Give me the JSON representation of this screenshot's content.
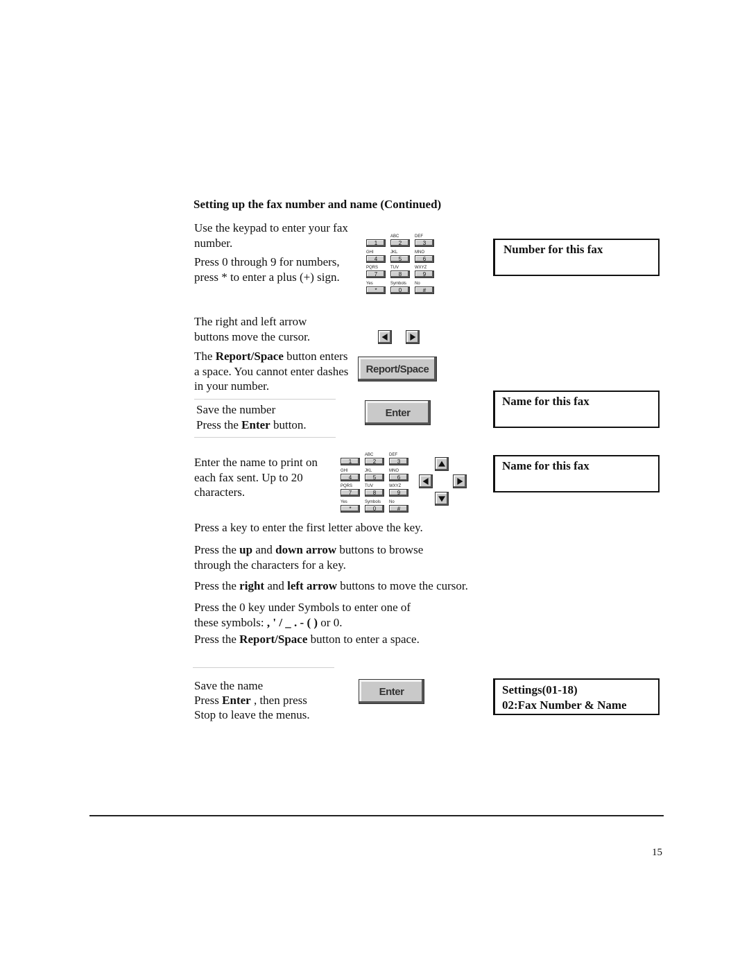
{
  "section_title": "Setting up the fax number and name (Continued)",
  "number_step": {
    "text_1": "Use the keypad to enter your fax number.",
    "text_2": "Press 0 through 9 for numbers, press * to enter a plus (+) sign.",
    "lcd": "Number for this fax"
  },
  "cursor_step": {
    "text": "The right and left arrow buttons move the cursor."
  },
  "space_step": {
    "text_pre": "The ",
    "text_bold": "Report/Space",
    "text_post": " button enters a space.  You cannot enter dashes in your number.",
    "button_label": "Report/Space"
  },
  "save_number_step": {
    "line_1": "Save the number",
    "line_2_pre": "Press the ",
    "line_2_bold": "Enter",
    "line_2_post": " button.",
    "button_label": "Enter",
    "lcd": "Name for this fax"
  },
  "name_step": {
    "text": "Enter the name to print on each fax sent.  Up to 20 characters.",
    "lcd": "Name for this fax"
  },
  "keypad": [
    {
      "sub": "",
      "key": "1"
    },
    {
      "sub": "ABC",
      "key": "2"
    },
    {
      "sub": "DEF",
      "key": "3"
    },
    {
      "sub": "GHI",
      "key": "4"
    },
    {
      "sub": "JKL",
      "key": "5"
    },
    {
      "sub": "MNO",
      "key": "6"
    },
    {
      "sub": "PQRS",
      "key": "7"
    },
    {
      "sub": "TUV",
      "key": "8"
    },
    {
      "sub": "WXYZ",
      "key": "9"
    },
    {
      "sub": "Yes",
      "key": "*"
    },
    {
      "sub": "Symbols",
      "key": "0"
    },
    {
      "sub": "No",
      "key": "#"
    }
  ],
  "instructions": {
    "p1": "Press a key to enter the first letter above the key.",
    "p2_a": "Press the ",
    "p2_b": "up",
    "p2_c": " and ",
    "p2_d": "down arrow",
    "p2_e": " buttons to browse",
    "p2_f": "through the characters  for a key.",
    "p3_a": "Press the ",
    "p3_b": "right",
    "p3_c": " and ",
    "p3_d": "left arrow",
    "p3_e": " buttons to move the cursor.",
    "p4_a": "Press the 0 key under Symbols to enter one of",
    "p4_b": "these symbols: ",
    "p4_c": ", ' / _ . - ( )",
    "p4_d": " or 0.",
    "p5_a": "Press the ",
    "p5_b": "Report/Space",
    "p5_c": " button to enter a space."
  },
  "save_name_step": {
    "line_1": "Save the name",
    "line_2_pre": "Press ",
    "line_2_bold": "Enter",
    "line_2_post": " , then press",
    "line_3": "Stop to leave the menus.",
    "button_label": "Enter",
    "lcd_line_1": "Settings(01-18)",
    "lcd_line_2": "02:Fax Number & Name"
  },
  "page_number": "15"
}
